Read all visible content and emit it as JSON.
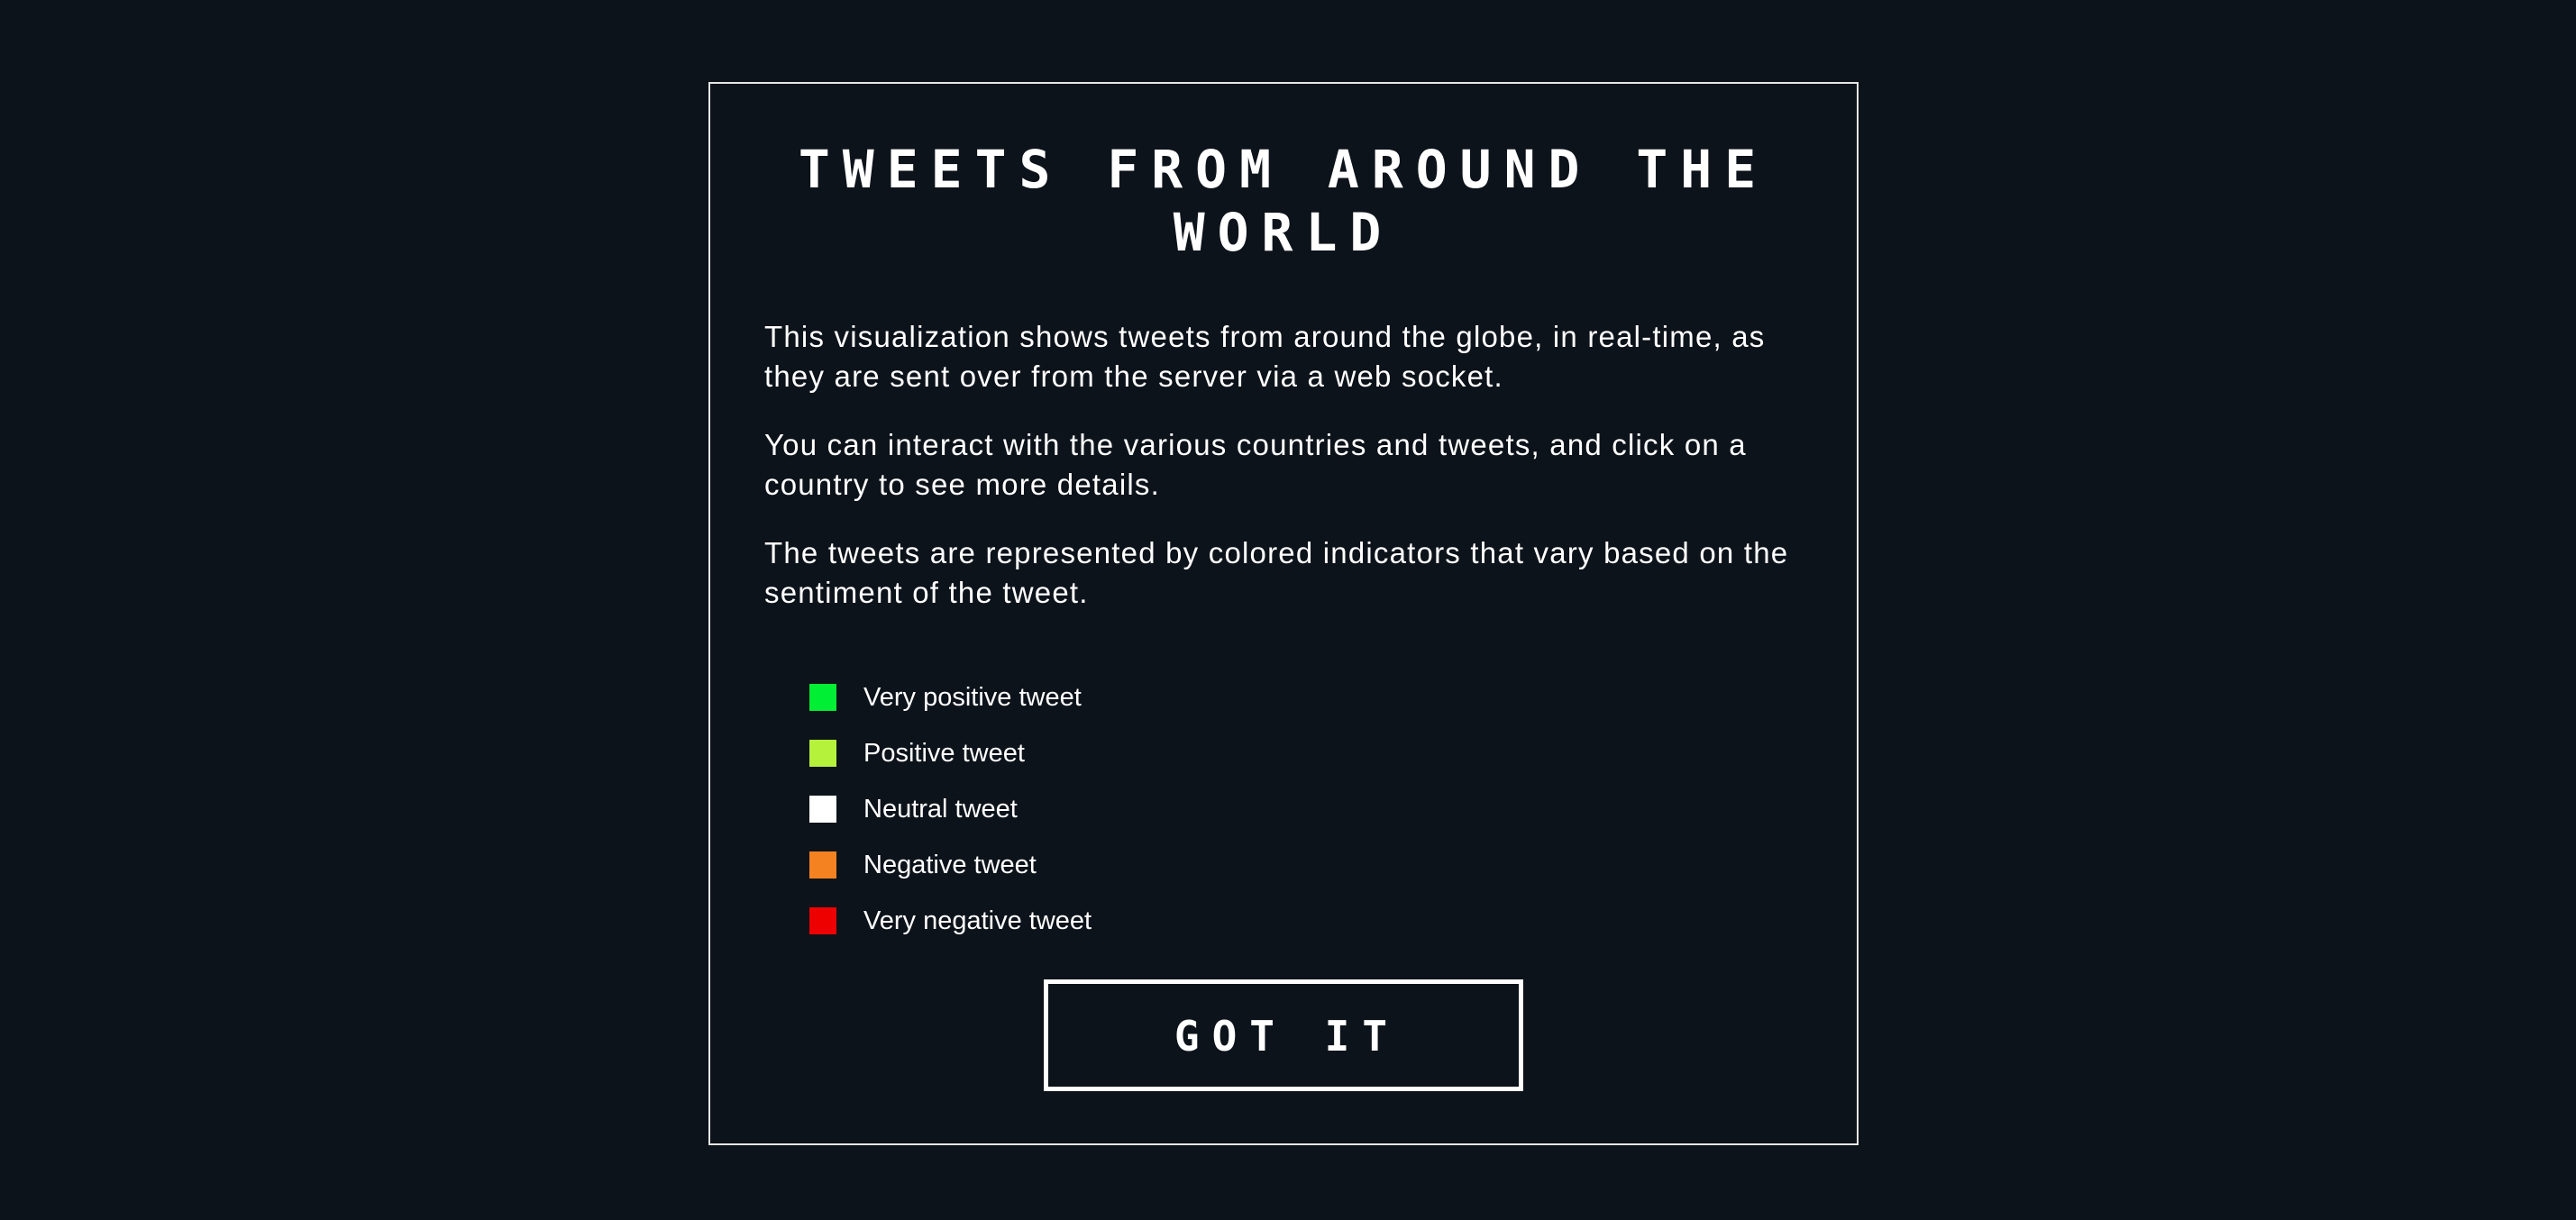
{
  "modal": {
    "title": "TWEETS FROM AROUND THE WORLD",
    "paragraphs": [
      "This visualization shows tweets from around the globe, in real-time, as they are sent over from the server via a web socket.",
      "You can interact with the various countries and tweets, and click on a country to see more details.",
      "The tweets are represented by colored indicators that vary based on the sentiment of the tweet."
    ],
    "legend": [
      {
        "label": "Very positive tweet",
        "color": "#00ee33"
      },
      {
        "label": "Positive tweet",
        "color": "#b5f23c"
      },
      {
        "label": "Neutral tweet",
        "color": "#ffffff"
      },
      {
        "label": "Negative tweet",
        "color": "#f58220"
      },
      {
        "label": "Very negative tweet",
        "color": "#ee0000"
      }
    ],
    "button_label": "GOT IT"
  },
  "colors": {
    "background": "#0d131a",
    "border": "#e6e6e6",
    "text": "#ffffff"
  }
}
